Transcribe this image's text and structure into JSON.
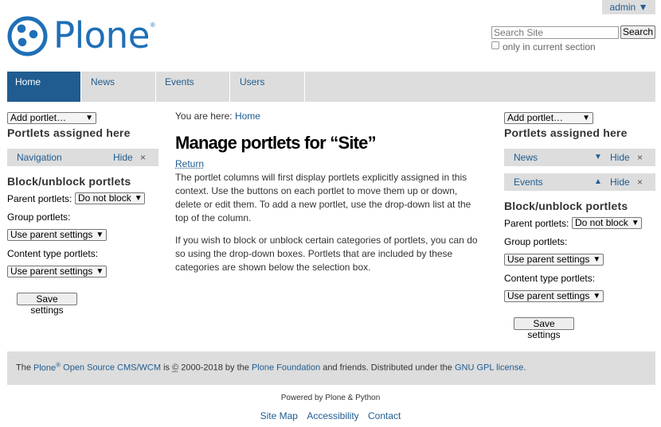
{
  "user_menu": {
    "label": "admin ▼"
  },
  "logo": {
    "text": "Plone",
    "mark": "®"
  },
  "search": {
    "placeholder": "Search Site",
    "button_label": "Search",
    "section_label": "only in current section"
  },
  "nav": {
    "tabs": [
      {
        "label": "Home",
        "active": true
      },
      {
        "label": "News",
        "active": false
      },
      {
        "label": "Events",
        "active": false
      },
      {
        "label": "Users",
        "active": false
      }
    ]
  },
  "left_column": {
    "add_portlet": "Add portlet…",
    "assigned_heading": "Portlets assigned here",
    "portlets": [
      {
        "name": "Navigation",
        "hide": "Hide",
        "remove": "×"
      }
    ],
    "block_heading": "Block/unblock portlets",
    "parent_label": "Parent portlets:",
    "parent_value": "Do not block",
    "group_label": "Group portlets:",
    "group_value": "Use parent settings",
    "content_type_label": "Content type portlets:",
    "content_type_value": "Use parent settings",
    "save_label": "Save settings"
  },
  "right_column": {
    "add_portlet": "Add portlet…",
    "assigned_heading": "Portlets assigned here",
    "portlets": [
      {
        "name": "News",
        "move": "▼",
        "hide": "Hide",
        "remove": "×"
      },
      {
        "name": "Events",
        "move": "▲",
        "hide": "Hide",
        "remove": "×"
      }
    ],
    "block_heading": "Block/unblock portlets",
    "parent_label": "Parent portlets:",
    "parent_value": "Do not block",
    "group_label": "Group portlets:",
    "group_value": "Use parent settings",
    "content_type_label": "Content type portlets:",
    "content_type_value": "Use parent settings",
    "save_label": "Save settings"
  },
  "main": {
    "breadcrumb_prefix": "You are here:",
    "breadcrumb_link": "Home",
    "title": "Manage portlets for “Site”",
    "return_label": "Return",
    "paragraph_1": "The portlet columns will first display portlets explicitly assigned in this context. Use the buttons on each portlet to move them up or down, delete or edit them. To add a new portlet, use the drop-down list at the top of the column.",
    "paragraph_2": "If you wish to block or unblock certain categories of portlets, you can do so using the drop-down boxes. Portlets that are included by these categories are shown below the selection box."
  },
  "footer": {
    "text_1": "The",
    "plone": "Plone",
    "reg": "®",
    "cms_link": "Open Source CMS/WCM",
    "text_2": "is",
    "copyright": "©",
    "text_3": "2000-2018 by the",
    "foundation_link": "Plone Foundation",
    "text_4": "and friends. Distributed under the",
    "license_link": "GNU GPL license",
    "text_5": "."
  },
  "powered_by": "Powered by Plone & Python",
  "site_actions": [
    "Site Map",
    "Accessibility",
    "Contact"
  ],
  "colors": {
    "link": "#205c90",
    "active_tab": "#205c90",
    "bar": "#dddddd",
    "logo": "#1f6fb7"
  }
}
